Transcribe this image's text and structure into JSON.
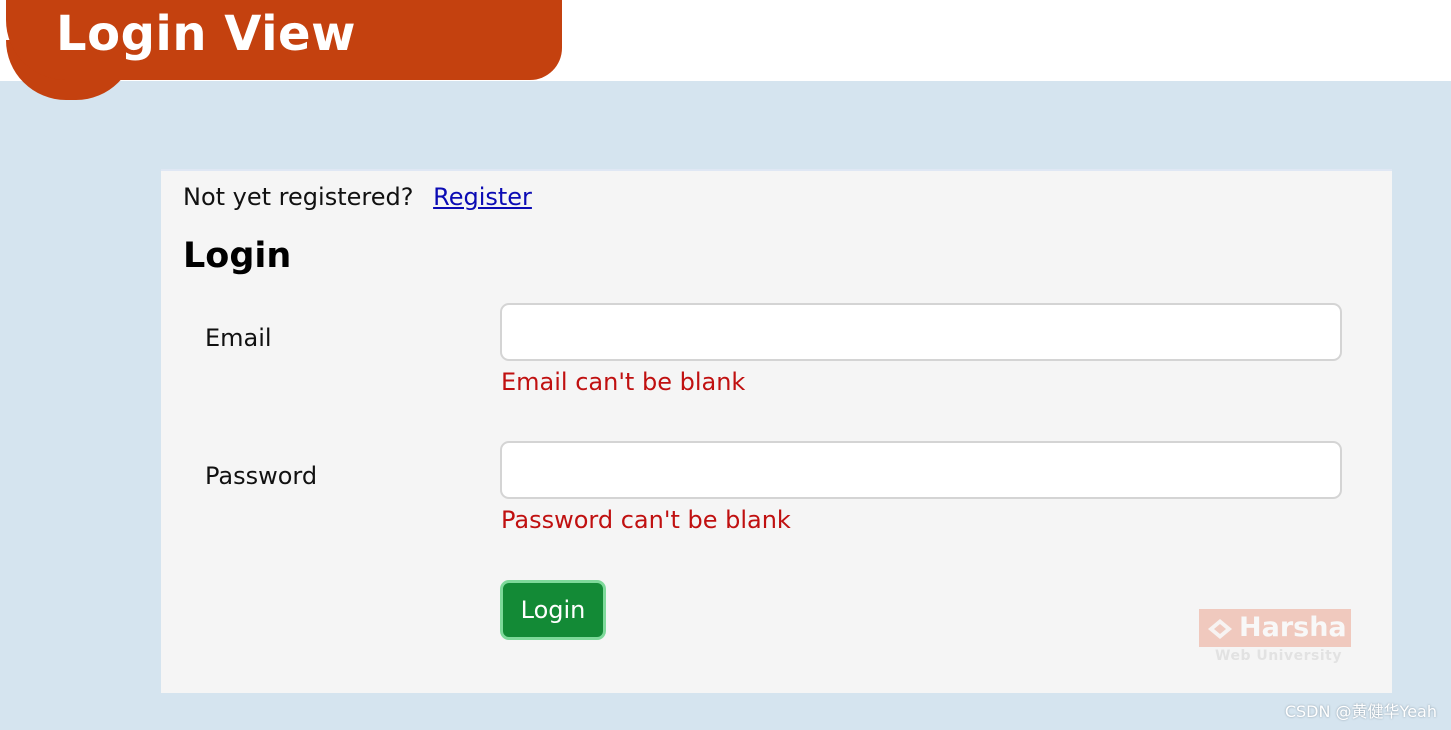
{
  "banner": {
    "title": "Login View",
    "color": "#c4410f"
  },
  "form": {
    "register_prompt": "Not yet registered?",
    "register_link": "Register",
    "title": "Login",
    "email": {
      "label": "Email",
      "value": "",
      "error": "Email can't be blank"
    },
    "password": {
      "label": "Password",
      "value": "",
      "error": "Password can't be blank"
    },
    "submit_label": "Login"
  },
  "colors": {
    "backdrop": "#d5e4ef",
    "card": "#f5f5f5",
    "link": "#0b0bb4",
    "error": "#c01010",
    "button": "#138a36",
    "button_border": "#7ed99a"
  },
  "watermark": {
    "brand": "Harsha",
    "sub": "Web University"
  },
  "credit": "CSDN @黄健华Yeah"
}
